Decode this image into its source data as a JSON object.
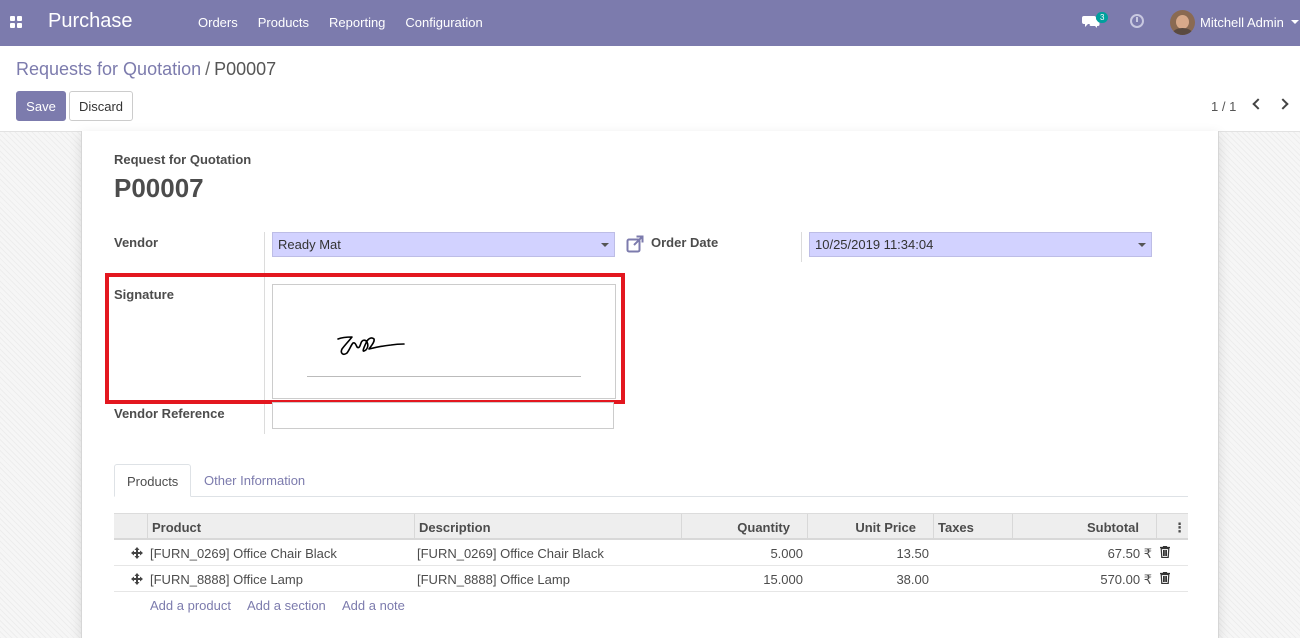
{
  "navbar": {
    "app_name": "Purchase",
    "menu": [
      "Orders",
      "Products",
      "Reporting",
      "Configuration"
    ],
    "message_count": "3",
    "user_name": "Mitchell Admin",
    "color": "#7c7bad"
  },
  "breadcrumb": {
    "parent": "Requests for Quotation",
    "separator": "/",
    "current": "P00007"
  },
  "toolbar": {
    "save_label": "Save",
    "discard_label": "Discard"
  },
  "pager": {
    "value": "1 / 1"
  },
  "form": {
    "subtitle": "Request for Quotation",
    "name": "P00007",
    "vendor_label": "Vendor",
    "vendor_value": "Ready Mat",
    "order_date_label": "Order Date",
    "order_date_value": "10/25/2019 11:34:04",
    "signature_label": "Signature",
    "vendor_reference_label": "Vendor Reference",
    "vendor_reference_value": "",
    "highlight_color": "#e3171f"
  },
  "tabs": [
    "Products",
    "Other Information"
  ],
  "table": {
    "headers": [
      "Product",
      "Description",
      "Quantity",
      "Unit Price",
      "Taxes",
      "Subtotal"
    ],
    "rows": [
      {
        "product": "[FURN_0269] Office Chair Black",
        "description": "[FURN_0269] Office Chair Black",
        "quantity": "5.000",
        "unit_price": "13.50",
        "taxes": "",
        "subtotal": "67.50 ₹"
      },
      {
        "product": "[FURN_8888] Office Lamp",
        "description": "[FURN_8888] Office Lamp",
        "quantity": "15.000",
        "unit_price": "38.00",
        "taxes": "",
        "subtotal": "570.00 ₹"
      }
    ],
    "add_links": [
      "Add a product",
      "Add a section",
      "Add a note"
    ]
  }
}
